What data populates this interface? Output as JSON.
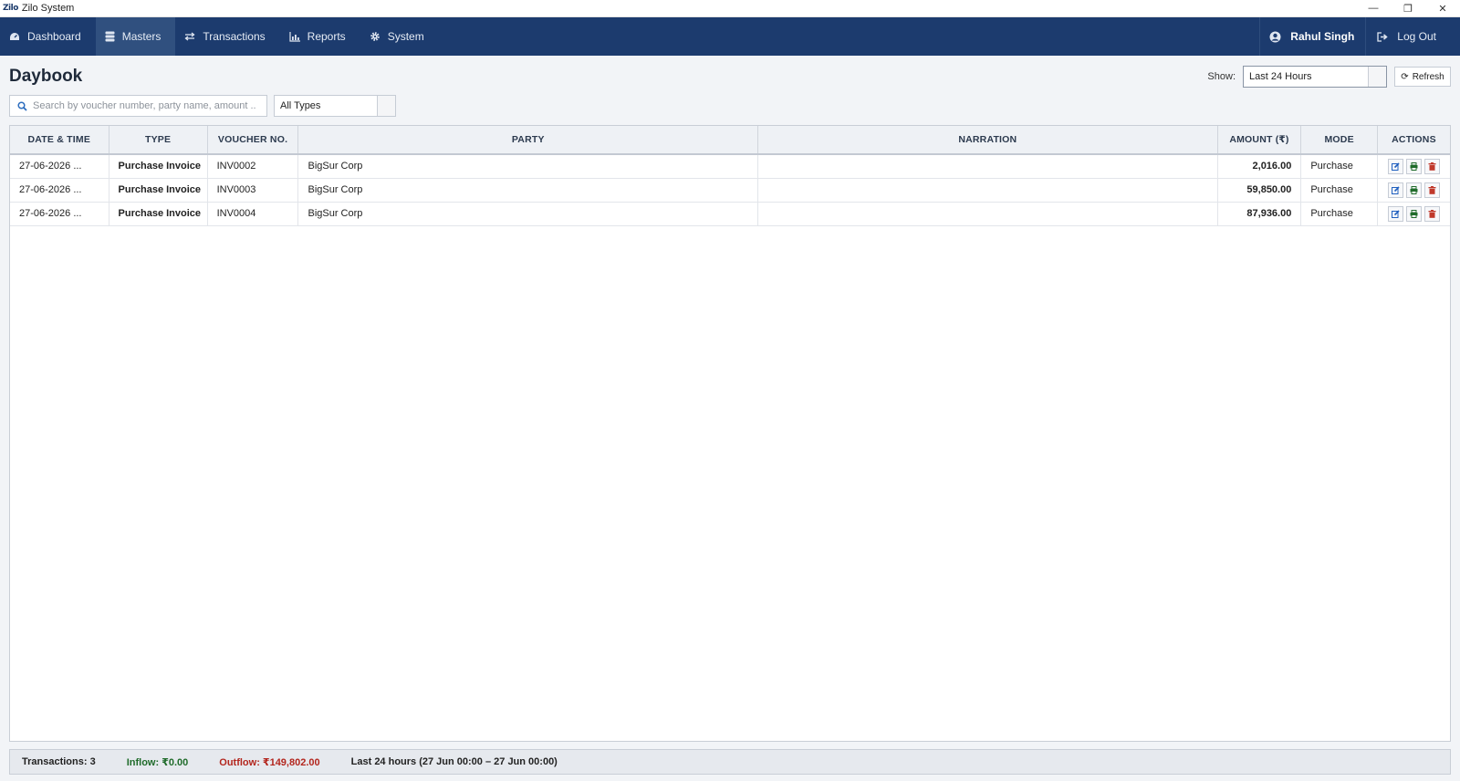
{
  "window": {
    "logo": "Zilo",
    "title": "Zilo System",
    "minimize": "—",
    "restore": "❐",
    "close": "✕"
  },
  "nav": {
    "items": [
      {
        "label": "Dashboard",
        "icon": "dashboard-icon"
      },
      {
        "label": "Masters",
        "icon": "database-icon",
        "active": true
      },
      {
        "label": "Transactions",
        "icon": "exchange-icon"
      },
      {
        "label": "Reports",
        "icon": "bar-chart-icon"
      },
      {
        "label": "System",
        "icon": "gear-icon"
      }
    ],
    "user": "Rahul Singh",
    "logout": "Log Out"
  },
  "page": {
    "title": "Daybook",
    "show_label": "Show:",
    "show_value": "Last 24 Hours",
    "refresh_label": "Refresh",
    "refresh_icon": "⟳"
  },
  "filters": {
    "search_placeholder": "Search by voucher number, party name, amount ...",
    "type_value": "All Types"
  },
  "table": {
    "headers": [
      "DATE & TIME",
      "TYPE",
      "VOUCHER NO.",
      "PARTY",
      "NARRATION",
      "AMOUNT (₹)",
      "MODE",
      "ACTIONS"
    ],
    "rows": [
      {
        "date": "27-06-2026  ...",
        "type": "Purchase Invoice",
        "voucher": "INV0002",
        "party": "BigSur Corp",
        "narration": "",
        "amount": "2,016.00",
        "mode": "Purchase"
      },
      {
        "date": "27-06-2026  ...",
        "type": "Purchase Invoice",
        "voucher": "INV0003",
        "party": "BigSur Corp",
        "narration": "",
        "amount": "59,850.00",
        "mode": "Purchase"
      },
      {
        "date": "27-06-2026  ...",
        "type": "Purchase Invoice",
        "voucher": "INV0004",
        "party": "BigSur Corp",
        "narration": "",
        "amount": "87,936.00",
        "mode": "Purchase"
      }
    ]
  },
  "footer": {
    "transactions": "Transactions: 3",
    "inflow": "Inflow: ₹0.00",
    "outflow": "Outflow: ₹149,802.00",
    "range": "Last 24 hours  (27 Jun 00:00 – 27 Jun 00:00)"
  },
  "colors": {
    "navbar": "#1c3b6e",
    "nav_active": "#30507f",
    "inflow": "#1f6b2a",
    "outflow": "#b3261e",
    "edit": "#1f5fbf",
    "print": "#1f6b2a",
    "delete": "#c0392b"
  }
}
